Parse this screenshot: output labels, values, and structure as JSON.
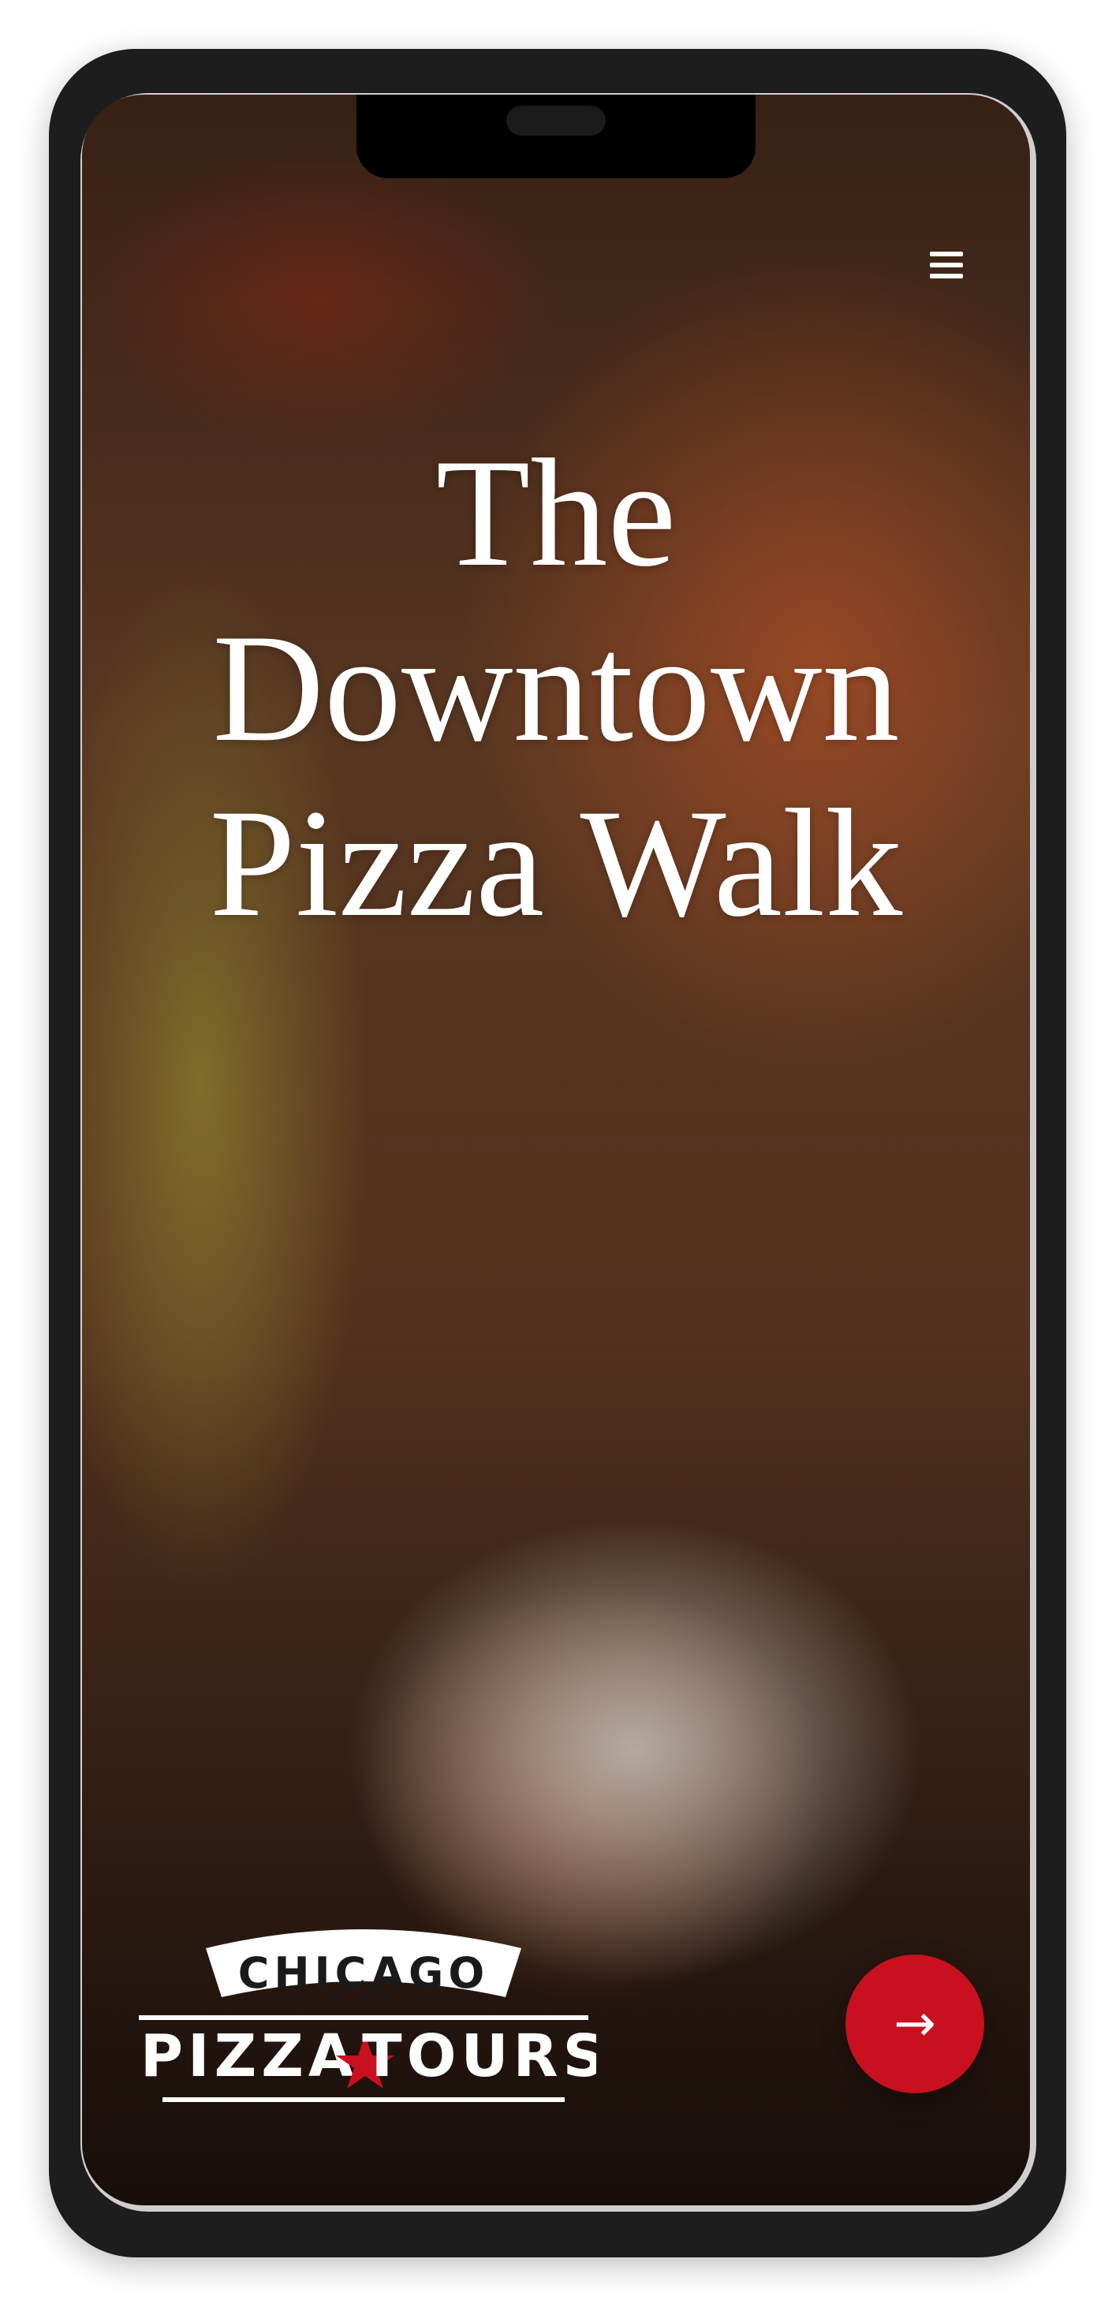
{
  "header": {
    "menu_icon": "hamburger-menu-icon"
  },
  "hero": {
    "title_lines": [
      "The",
      "Downtown",
      "Pizza Walk"
    ]
  },
  "brand": {
    "logo_top": "CHICAGO",
    "logo_left": "PIZZA",
    "logo_right": "TOURS",
    "star_color": "#c8101e"
  },
  "cta": {
    "icon": "arrow-right-icon",
    "glyph": "→",
    "color": "#c8101e"
  }
}
